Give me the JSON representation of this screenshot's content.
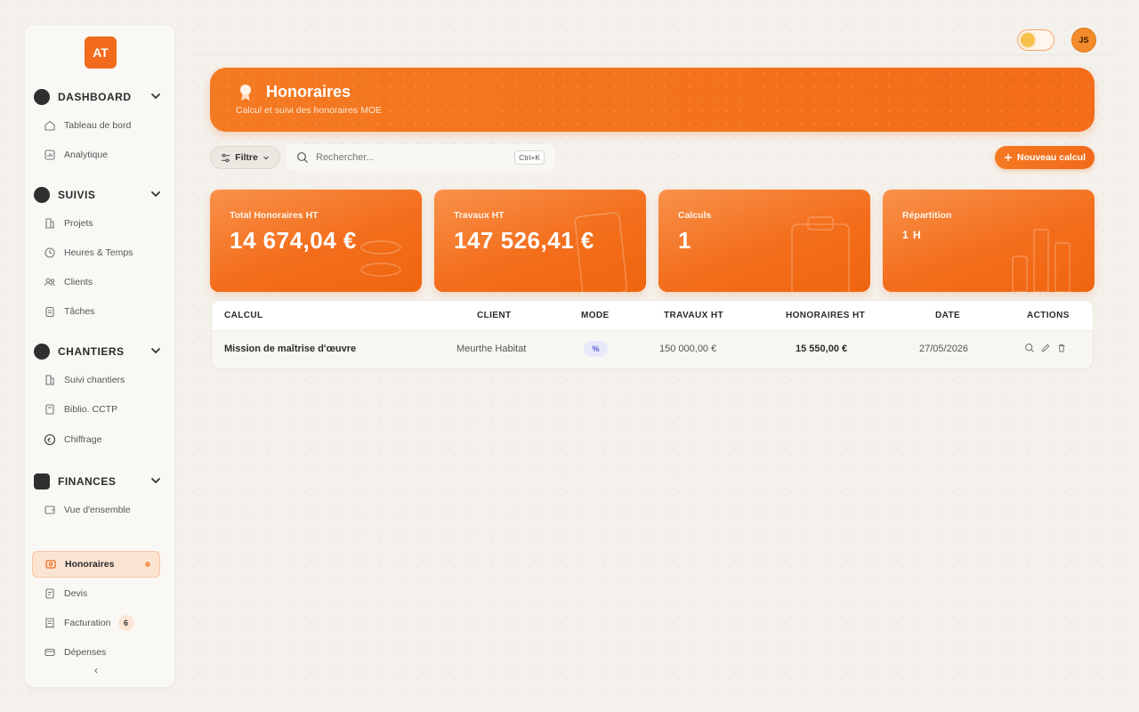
{
  "sidebar": {
    "logo": "AT",
    "sections": [
      {
        "label": "DASHBOARD",
        "items": [
          "Tableau de bord",
          "Analytique"
        ]
      },
      {
        "label": "SUIVIS",
        "items": [
          "Projets",
          "Heures & Temps",
          "Clients",
          "Tâches"
        ]
      },
      {
        "label": "CHANTIERS",
        "items": [
          "Suivi chantiers",
          "Biblio. CCTP",
          "Chiffrage"
        ]
      },
      {
        "label": "FINANCES",
        "items": [
          "Vue d'ensemble",
          "Honoraires",
          "Devis",
          "Facturation",
          "Dépenses"
        ]
      }
    ],
    "active_item": "Honoraires",
    "facturation_badge": "6",
    "collapse_icon": "‹"
  },
  "topbar": {
    "avatar_initials": "JS",
    "theme_toggle": "light"
  },
  "banner": {
    "title": "Honoraires",
    "subtitle": "Calcul et suivi des honoraires MOE"
  },
  "toolbar": {
    "filter_label": "Filtre",
    "search_placeholder": "Rechercher...",
    "search_shortcut": "Ctrl+K",
    "new_button_label": "Nouveau calcul"
  },
  "stats": [
    {
      "label": "Total Honoraires HT",
      "value": "14 674,04 €"
    },
    {
      "label": "Travaux HT",
      "value": "147 526,41 €"
    },
    {
      "label": "Calculs",
      "value": "1"
    },
    {
      "label": "Répartition",
      "value": "1 H"
    }
  ],
  "table": {
    "columns": [
      "CALCUL",
      "CLIENT",
      "MODE",
      "TRAVAUX HT",
      "HONORAIRES HT",
      "DATE",
      "ACTIONS"
    ],
    "rows": [
      {
        "calcul": "Mission de maîtrise d'œuvre",
        "client": "Meurthe Habitat",
        "mode": "%",
        "travaux": "150 000,00 €",
        "honoraires": "15 550,00 €",
        "date": "27/05/2026"
      }
    ]
  },
  "colors": {
    "accent": "#f36c18",
    "background": "#f4f1ec",
    "mode_pill": "#e7e9fb"
  }
}
